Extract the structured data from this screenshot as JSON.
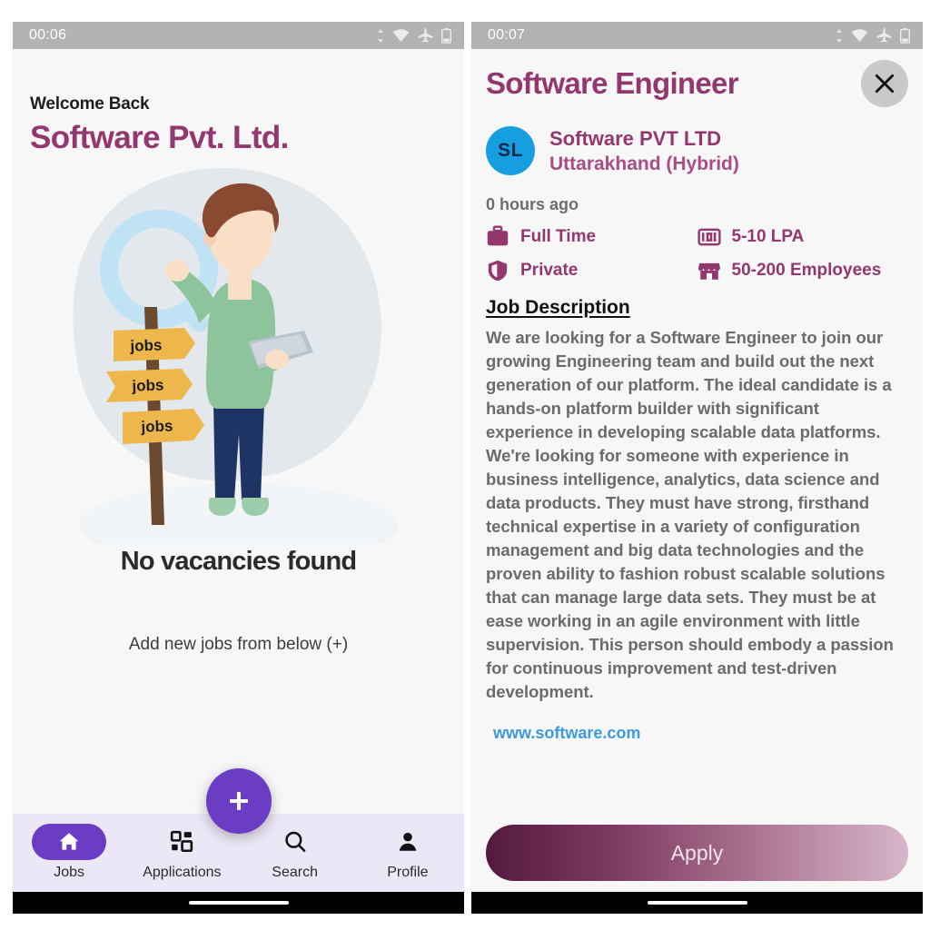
{
  "left_screen": {
    "status_bar": {
      "time": "00:06",
      "icons": [
        "data-transfer-icon",
        "wifi-icon",
        "airplane-mode-icon",
        "battery-icon"
      ]
    },
    "welcome_label": "Welcome Back",
    "company_name": "Software Pvt. Ltd.",
    "illustration": {
      "name": "job-search-illustration",
      "sign_labels": [
        "jobs",
        "jobs",
        "jobs"
      ]
    },
    "empty_title": "No vacancies found",
    "empty_subtitle": "Add new jobs from below (+)",
    "fab_label": "+",
    "nav": {
      "items": [
        {
          "label": "Jobs",
          "icon": "home-icon",
          "active": true
        },
        {
          "label": "Applications",
          "icon": "grid-icon",
          "active": false
        },
        {
          "label": "Search",
          "icon": "search-icon",
          "active": false
        },
        {
          "label": "Profile",
          "icon": "person-icon",
          "active": false
        }
      ]
    }
  },
  "right_screen": {
    "status_bar": {
      "time": "00:07",
      "icons": [
        "data-transfer-icon",
        "wifi-icon",
        "airplane-mode-icon",
        "battery-icon"
      ]
    },
    "job_title": "Software Engineer",
    "close_label": "×",
    "avatar_initials": "SL",
    "company_name": "Software PVT LTD",
    "company_location": "Uttarakhand (Hybrid)",
    "posted": "0 hours ago",
    "meta": [
      {
        "icon": "briefcase-icon",
        "text": "Full Time"
      },
      {
        "icon": "money-icon",
        "text": "5-10 LPA"
      },
      {
        "icon": "shield-icon",
        "text": "Private"
      },
      {
        "icon": "store-icon",
        "text": "50-200 Employees"
      }
    ],
    "description_heading": "Job Description",
    "description": "We are looking for a Software Engineer to join our growing Engineering team and build out the next generation of our platform. The ideal candidate is a hands-on platform builder with significant experience in developing scalable data platforms. We're looking for someone with experience in business intelligence, analytics, data science and data products. They must have strong, firsthand technical expertise in a variety of configuration management and big data technologies and the proven ability to fashion robust scalable solutions that can manage large data sets. They must be at ease working in an agile environment with little supervision. This person should embody a passion for continuous improvement and test-driven development.",
    "website": "www.software.com",
    "apply_label": "Apply"
  },
  "colors": {
    "brand_purple": "#93376f",
    "accent_violet": "#6b3cc4",
    "nav_background": "#ece7f6",
    "avatar_blue": "#169fe0",
    "link_blue": "#3b9ae1",
    "screen_background": "#f8f7f7",
    "status_bar": "#b3b3b3"
  }
}
